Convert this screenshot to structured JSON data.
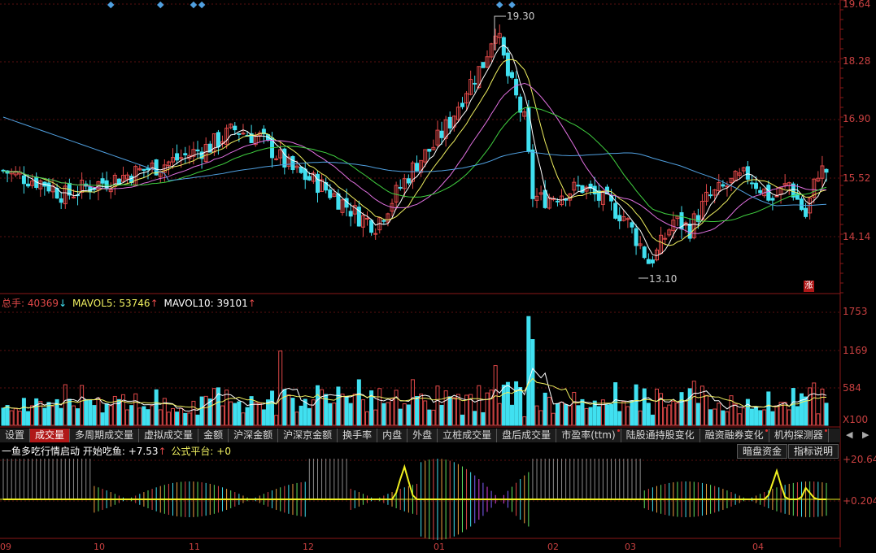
{
  "colors": {
    "up": "#e04848",
    "down": "#40e0f0",
    "axis": "#c84040",
    "ma5": "#ffffff",
    "ma10": "#f0f060",
    "ma20": "#e070e0",
    "ma30": "#40d040",
    "ma60": "#50a0e0"
  },
  "price_panel": {
    "axis_labels": [
      "19.64",
      "18.28",
      "16.90",
      "15.52",
      "14.14"
    ],
    "high_label": "19.30",
    "low_label": "13.10",
    "zhang_badge": "涨",
    "price_min": 12.8,
    "price_max": 19.64,
    "markers_at_index": [
      26,
      38,
      46,
      48,
      120,
      123
    ]
  },
  "volume_panel": {
    "legend": {
      "total_label": "总手:",
      "total_value": "40369",
      "total_arrow": "↓",
      "ma5_label": "MAVOL5:",
      "ma5_value": "53746",
      "ma5_arrow": "↑",
      "ma10_label": "MAVOL10:",
      "ma10_value": "39101",
      "ma10_arrow": "↑"
    },
    "axis_labels": [
      "1753",
      "1169",
      "584",
      "X100"
    ],
    "vol_max": 1753
  },
  "tabs": [
    {
      "label": "设置",
      "active": false,
      "dot": false
    },
    {
      "label": "成交量",
      "active": true,
      "dot": false
    },
    {
      "label": "多周期成交量",
      "active": false,
      "dot": false
    },
    {
      "label": "虚拟成交量",
      "active": false,
      "dot": false
    },
    {
      "label": "金额",
      "active": false,
      "dot": false
    },
    {
      "label": "沪深金额",
      "active": false,
      "dot": false
    },
    {
      "label": "沪深京金额",
      "active": false,
      "dot": false
    },
    {
      "label": "换手率",
      "active": false,
      "dot": false
    },
    {
      "label": "内盘",
      "active": false,
      "dot": false
    },
    {
      "label": "外盘",
      "active": false,
      "dot": false
    },
    {
      "label": "立桩成交量",
      "active": false,
      "dot": false
    },
    {
      "label": "盘后成交量",
      "active": false,
      "dot": false
    },
    {
      "label": "市盈率(ttm)",
      "active": false,
      "dot": true
    },
    {
      "label": "陆股通持股变化",
      "active": false,
      "dot": false
    },
    {
      "label": "融资融券变化",
      "active": false,
      "dot": true
    },
    {
      "label": "机构探测器",
      "active": false,
      "dot": true
    }
  ],
  "tab_nav": {
    "prev": "◀",
    "next": "▶"
  },
  "indicator_panel": {
    "title": "一鱼多吃行情启动",
    "start_label": "开始吃鱼:",
    "start_value": "+7.53",
    "start_arrow": "↑",
    "platform_label": "公式平台:",
    "platform_value": "+0",
    "buttons": {
      "dark_fund": "暗盘资金",
      "indicator_help": "指标说明"
    },
    "axis_labels": [
      "+20.64",
      "+0.204"
    ]
  },
  "date_axis": [
    "09",
    "10",
    "11",
    "12",
    "01",
    "02",
    "03",
    "04"
  ]
}
